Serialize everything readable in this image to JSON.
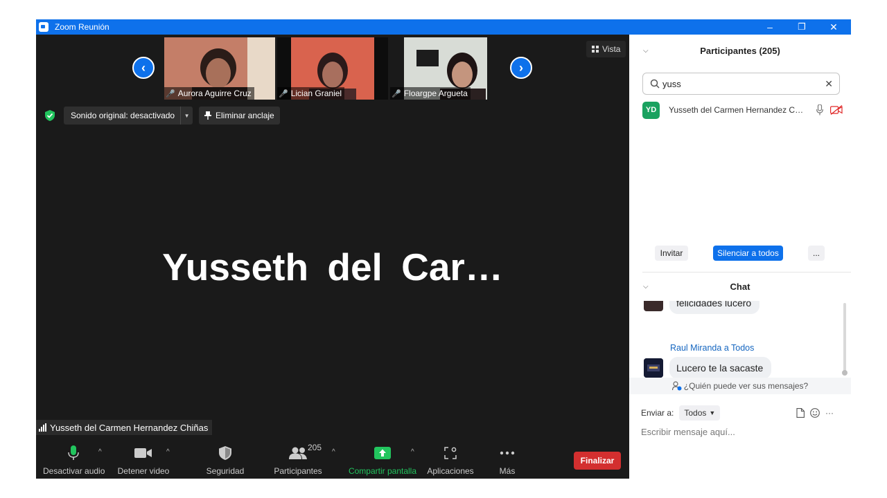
{
  "window": {
    "title": "Zoom Reunión",
    "minimize": "–",
    "restore": "❐",
    "close": "✕"
  },
  "gallery": {
    "prev": "‹",
    "next": "›",
    "view_label": "Vista",
    "thumbnails": [
      {
        "name": "Aurora Aguirre Cruz"
      },
      {
        "name": "Lician Graniel"
      },
      {
        "name": "Floargpe Argueta"
      }
    ]
  },
  "controls": {
    "original_sound": "Sonido original: desactivado",
    "unpin": "Eliminar anclaje"
  },
  "main": {
    "active_speaker_display": "Yusseth del Car…",
    "speaker_label": "Yusseth del Carmen Hernandez Chiñas"
  },
  "toolbar": {
    "audio": "Desactivar audio",
    "video": "Detener video",
    "security": "Seguridad",
    "participants": "Participantes",
    "participants_count": "205",
    "share": "Compartir pantalla",
    "apps": "Aplicaciones",
    "more": "Más",
    "end": "Finalizar"
  },
  "participants_panel": {
    "title": "Participantes (205)",
    "search_value": "yuss",
    "results": [
      {
        "initials": "YD",
        "name": "Yusseth del Carmen Hernandez C…"
      }
    ],
    "invite": "Invitar",
    "mute_all": "Silenciar a todos",
    "more": "..."
  },
  "chat": {
    "title": "Chat",
    "messages": [
      {
        "sender": "",
        "text": "felicidades lucero"
      },
      {
        "sender": "Raul Miranda a Todos",
        "text": "Lucero te la sacaste"
      }
    ],
    "who_can_see": "¿Quién puede ver sus mensajes?",
    "send_to_label": "Enviar a:",
    "send_to_value": "Todos",
    "compose_placeholder": "Escribir mensaje aquí..."
  },
  "colors": {
    "accent": "#0e71eb",
    "end": "#d32f2f",
    "share": "#22c55e"
  }
}
